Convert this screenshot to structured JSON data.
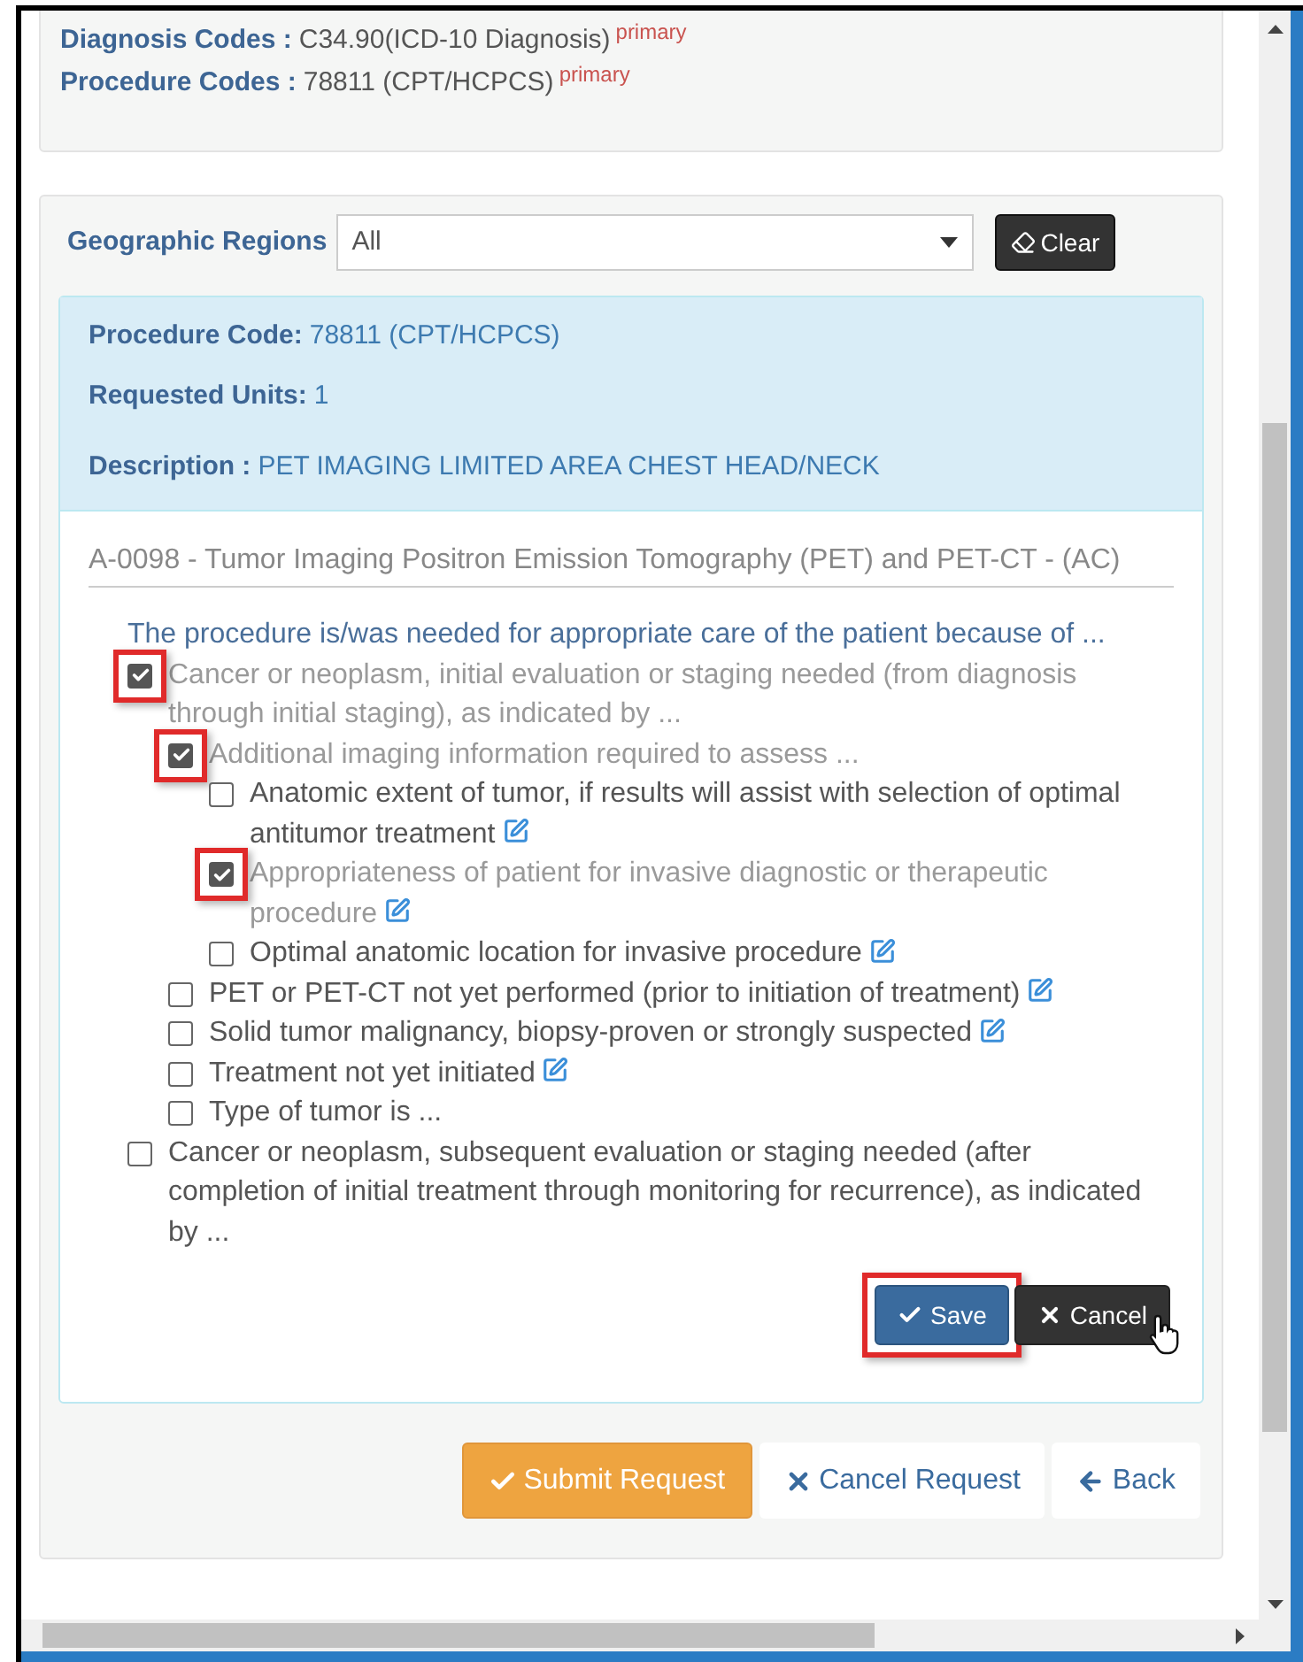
{
  "summary": {
    "rows": [
      {
        "label": "Diagnosis Codes :",
        "value": "C34.90(ICD-10 Diagnosis)",
        "tag": "primary"
      },
      {
        "label": "Procedure Codes :",
        "value": "78811 (CPT/HCPCS)",
        "tag": "primary"
      }
    ]
  },
  "filter": {
    "label": "Geographic Regions",
    "value": "All",
    "clear_button": "Clear"
  },
  "procedure": {
    "rows": [
      {
        "label": "Procedure Code:",
        "value": "78811 (CPT/HCPCS)"
      },
      {
        "label": "Requested Units:",
        "value": "1"
      },
      {
        "label": "Description :",
        "value": "PET IMAGING LIMITED AREA CHEST HEAD/NECK"
      }
    ]
  },
  "guideline": {
    "title": "A-0098 - Tumor Imaging Positron Emission Tomography (PET) and PET-CT - (AC)",
    "prompt": "The procedure is/was needed for appropriate care of the patient because of ...",
    "items": [
      {
        "text": "Cancer or neoplasm, initial evaluation or staging needed (from diagnosis through initial staging), as indicated by ...",
        "checked": true,
        "highlighted": true,
        "editable": false,
        "children": [
          {
            "text": "Additional imaging information required to assess ...",
            "checked": true,
            "highlighted": true,
            "editable": false,
            "children": [
              {
                "text": "Anatomic extent of tumor, if results will assist with selection of optimal antitumor treatment",
                "checked": false,
                "highlighted": false,
                "editable": true
              },
              {
                "text": "Appropriateness of patient for invasive diagnostic or therapeutic procedure",
                "checked": true,
                "highlighted": true,
                "editable": true
              },
              {
                "text": "Optimal anatomic location for invasive procedure",
                "checked": false,
                "highlighted": false,
                "editable": true
              }
            ]
          },
          {
            "text": "PET or PET-CT not yet performed (prior to initiation of treatment)",
            "checked": false,
            "highlighted": false,
            "editable": true
          },
          {
            "text": "Solid tumor malignancy, biopsy-proven or strongly suspected",
            "checked": false,
            "highlighted": false,
            "editable": true
          },
          {
            "text": "Treatment not yet initiated",
            "checked": false,
            "highlighted": false,
            "editable": true
          },
          {
            "text": "Type of tumor is ...",
            "checked": false,
            "highlighted": false,
            "editable": false
          }
        ]
      },
      {
        "text": "Cancer or neoplasm, subsequent evaluation or staging needed (after completion of initial treatment through monitoring for recurrence), as indicated by ...",
        "checked": false,
        "highlighted": false,
        "editable": false
      }
    ]
  },
  "form_buttons": [
    {
      "label": "Save",
      "kind": "save",
      "highlighted": true,
      "pointer": false
    },
    {
      "label": "Cancel",
      "kind": "cancel",
      "highlighted": false,
      "pointer": true
    }
  ],
  "actions": [
    {
      "label": "Submit Request",
      "kind": "submit"
    },
    {
      "label": "Cancel Request",
      "kind": "cancel"
    },
    {
      "label": "Back",
      "kind": "back"
    }
  ]
}
